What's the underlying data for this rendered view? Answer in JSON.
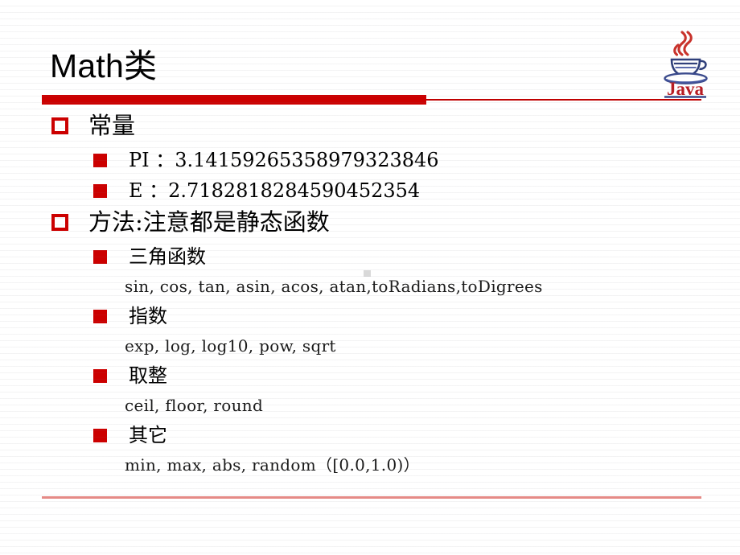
{
  "slide": {
    "title": "Math类",
    "accent_color": "#cc0000",
    "rule_color": "#c00000",
    "bottom_rule_color": "#e58a86",
    "logo_name": "java-logo",
    "logo_wordmark": "Java"
  },
  "content": {
    "constants_heading": "常量",
    "constants": [
      {
        "label": "PI ：3.14159265358979323846"
      },
      {
        "label": "E ：2.7182818284590452354"
      }
    ],
    "methods_heading": "方法:注意都是静态函数",
    "method_groups": [
      {
        "heading": "三角函数",
        "items": "sin, cos, tan, asin, acos, atan,toRadians,toDigrees"
      },
      {
        "heading": "指数",
        "items": "exp, log, log10, pow, sqrt"
      },
      {
        "heading": "取整",
        "items": "ceil, floor, round"
      },
      {
        "heading": "其它",
        "items": "min, max, abs, random（[0.0,1.0)）"
      }
    ]
  }
}
